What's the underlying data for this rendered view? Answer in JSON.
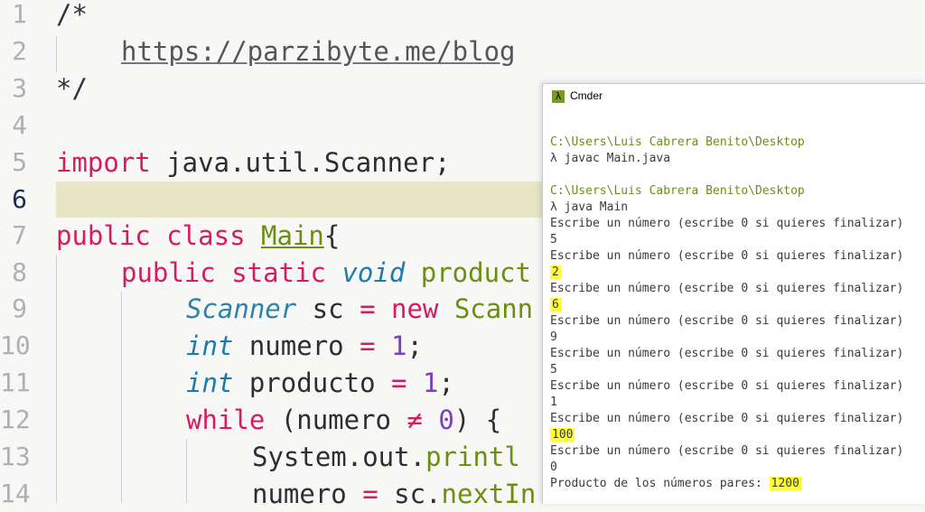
{
  "editor": {
    "line_numbers": [
      "1",
      "2",
      "3",
      "4",
      "5",
      "6",
      "7",
      "8",
      "9",
      "10",
      "11",
      "12",
      "13",
      "14"
    ],
    "line1": "/*",
    "line2_url": "https://parzibyte.me/blog",
    "line3": "*/",
    "line5": {
      "import": "import",
      "pkg": " java.util.Scanner;"
    },
    "line7": {
      "public": "public",
      "class": " class ",
      "name": "Main",
      "brace": "{"
    },
    "line8": {
      "public": "public",
      "static": " static ",
      "void": "void",
      "name": " product"
    },
    "line9": {
      "type": "Scanner",
      "var": " sc ",
      "eq": "=",
      "new": " new ",
      "cls": "Scann"
    },
    "line10": {
      "type": "int",
      "var": " numero ",
      "eq": "=",
      "val": " 1",
      "end": ";"
    },
    "line11": {
      "type": "int",
      "var": " producto ",
      "eq": "=",
      "val": " 1",
      "end": ";"
    },
    "line12": {
      "while": "while",
      "open": " (numero ",
      "neq": "≠",
      "val": " 0",
      "close": ") {"
    },
    "line13": {
      "obj": "System.out.",
      "method": "printl"
    },
    "line14": {
      "var": "numero ",
      "eq": "=",
      "obj": " sc.",
      "method": "nextIn"
    }
  },
  "terminal": {
    "title": "Cmder",
    "icon": "lambda-icon",
    "lines": [
      {
        "text": "C:\\Users\\Luis Cabrera Benito\\Desktop",
        "kind": "path"
      },
      {
        "text": "λ javac Main.java",
        "kind": "cmd"
      },
      {
        "text": "",
        "kind": "blank"
      },
      {
        "text": "C:\\Users\\Luis Cabrera Benito\\Desktop",
        "kind": "path"
      },
      {
        "text": "λ java Main",
        "kind": "cmd"
      },
      {
        "text": "Escribe un número (escribe 0 si quieres finalizar)",
        "kind": "out"
      },
      {
        "text": "5",
        "kind": "out"
      },
      {
        "text": "Escribe un número (escribe 0 si quieres finalizar)",
        "kind": "out"
      },
      {
        "text": "2",
        "kind": "highlight"
      },
      {
        "text": "Escribe un número (escribe 0 si quieres finalizar)",
        "kind": "out"
      },
      {
        "text": "6",
        "kind": "highlight"
      },
      {
        "text": "Escribe un número (escribe 0 si quieres finalizar)",
        "kind": "out"
      },
      {
        "text": "9",
        "kind": "out"
      },
      {
        "text": "Escribe un número (escribe 0 si quieres finalizar)",
        "kind": "out"
      },
      {
        "text": "5",
        "kind": "out"
      },
      {
        "text": "Escribe un número (escribe 0 si quieres finalizar)",
        "kind": "out"
      },
      {
        "text": "1",
        "kind": "out"
      },
      {
        "text": "Escribe un número (escribe 0 si quieres finalizar)",
        "kind": "out"
      },
      {
        "text": "100",
        "kind": "highlight"
      },
      {
        "text": "Escribe un número (escribe 0 si quieres finalizar)",
        "kind": "out"
      },
      {
        "text": "0",
        "kind": "out"
      }
    ],
    "result_label": "Producto de los números pares: ",
    "result_value": "1200"
  },
  "colors": {
    "keyword": "#d81b60",
    "type": "#1b7ab0",
    "name": "#6a8f12",
    "number": "#7b3fbf",
    "path": "#6e8c1e",
    "highlight": "#ffff33",
    "current_line": "#e8e5c6"
  }
}
